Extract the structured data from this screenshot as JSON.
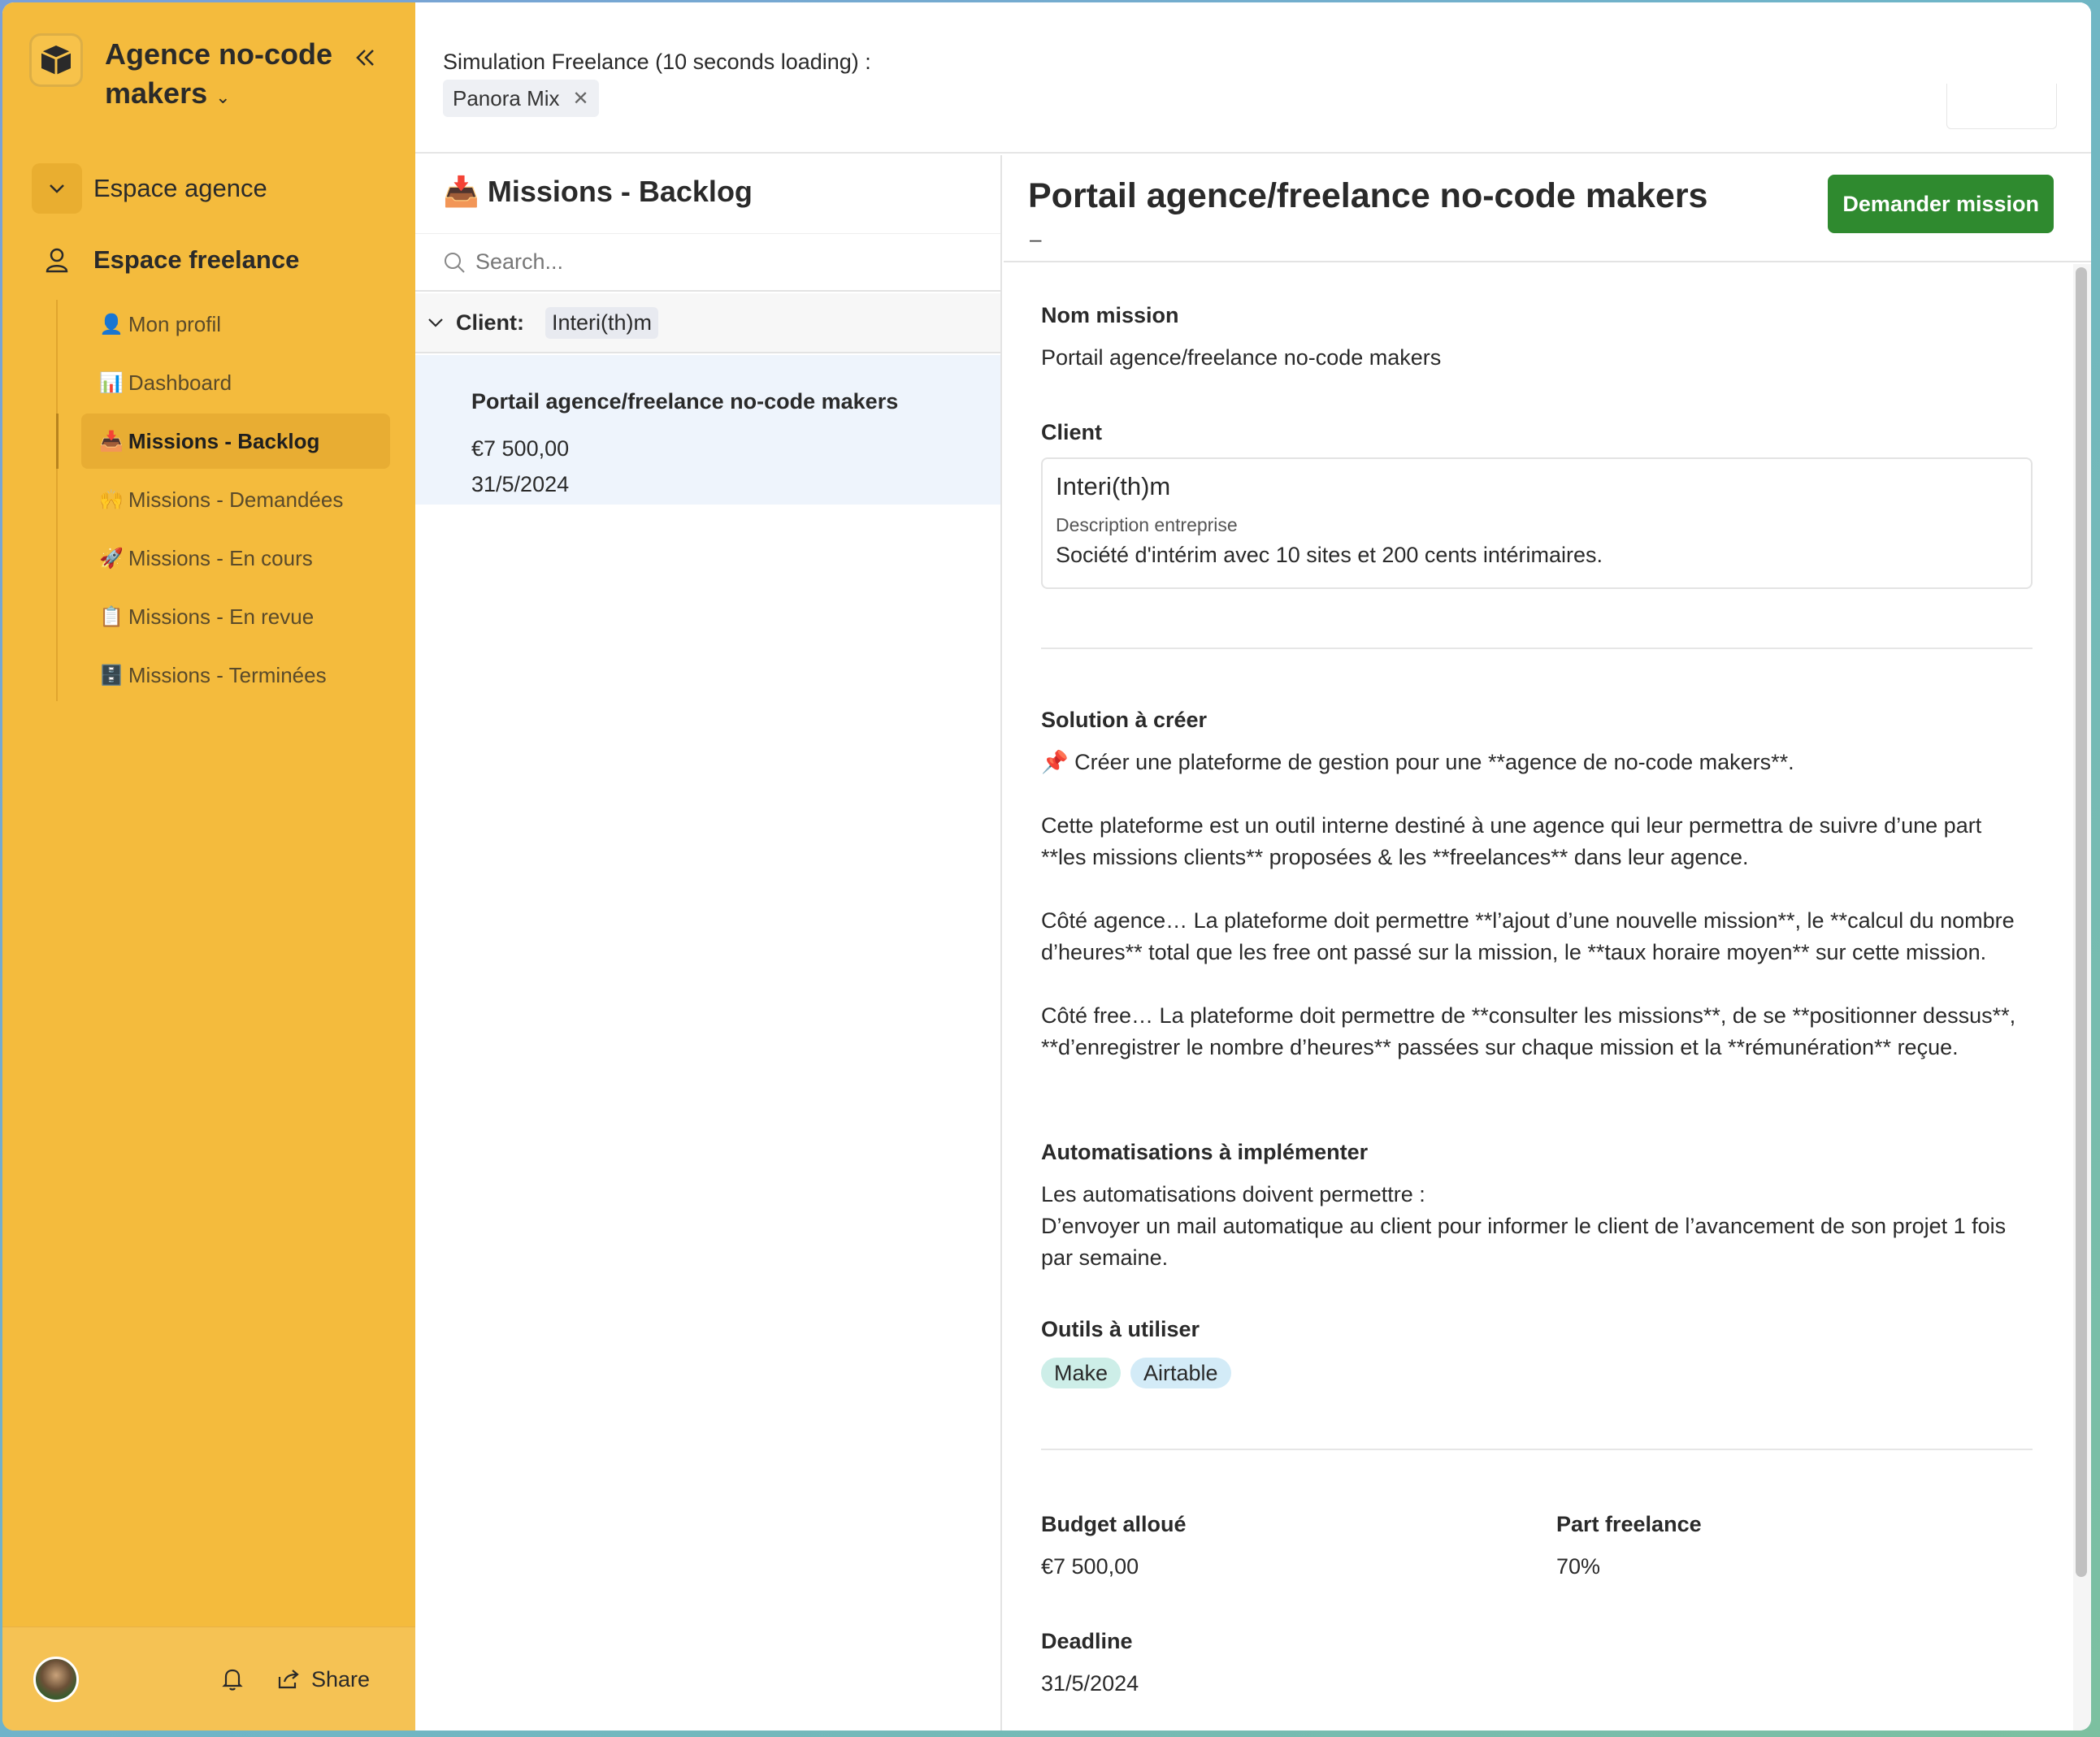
{
  "sidebar": {
    "org_name": "Agence no-code makers",
    "sections": [
      {
        "label": "Espace agence"
      },
      {
        "label": "Espace freelance"
      }
    ],
    "items": [
      {
        "emoji": "👤",
        "label": "Mon profil"
      },
      {
        "emoji": "📊",
        "label": "Dashboard"
      },
      {
        "emoji": "📥",
        "label": "Missions - Backlog"
      },
      {
        "emoji": "🙌",
        "label": "Missions - Demandées"
      },
      {
        "emoji": "🚀",
        "label": "Missions - En cours"
      },
      {
        "emoji": "📋",
        "label": "Missions - En revue"
      },
      {
        "emoji": "🗄️",
        "label": "Missions - Terminées"
      }
    ],
    "footer": {
      "share_label": "Share"
    }
  },
  "header": {
    "simulation_label": "Simulation Freelance (10 seconds loading) :",
    "chip_label": "Panora Mix",
    "chip_close": "✕"
  },
  "list": {
    "title_emoji": "📥",
    "title": "Missions - Backlog",
    "search_placeholder": "Search...",
    "group_label": "Client:",
    "group_value": "Interi(th)m",
    "card": {
      "title": "Portail agence/freelance no-code makers",
      "budget": "€7 500,00",
      "date": "31/5/2024"
    }
  },
  "detail": {
    "title": "Portail agence/freelance no-code makers",
    "subtitle_dash": "–",
    "demand_button": "Demander mission",
    "nom_mission_label": "Nom mission",
    "nom_mission_value": "Portail agence/freelance no-code makers",
    "client_label": "Client",
    "client": {
      "name": "Interi(th)m",
      "desc_label": "Description entreprise",
      "desc_value": "Société d'intérim avec 10 sites et 200 cents intérimaires."
    },
    "solution_label": "Solution à créer",
    "solution_p1": "📌 Créer une plateforme de gestion pour une **agence de no-code makers**.",
    "solution_p2a": "Cette plateforme est un outil interne destiné à une agence qui leur permettra de suivre d’une part",
    "solution_p2b": "**les missions clients** proposées & les **freelances** dans leur agence.",
    "solution_p3a": "Côté agence… La plateforme doit permettre **l’ajout d’une nouvelle mission**, le **calcul du nombre",
    "solution_p3b": "d’heures** total que les free ont passé sur la mission, le **taux horaire moyen** sur cette mission.",
    "solution_p4a": "Côté free… La plateforme doit permettre de **consulter les missions**, de se **positionner dessus**,",
    "solution_p4b": "**d’enregistrer le nombre d’heures** passées sur chaque mission et la **rémunération** reçue.",
    "auto_label": "Automatisations à implémenter",
    "auto_p1": "Les automatisations doivent permettre :",
    "auto_p2a": "D’envoyer un mail automatique au client pour informer le client de l’avancement de son projet 1 fois",
    "auto_p2b": "par semaine.",
    "tools_label": "Outils à utiliser",
    "tools": [
      {
        "label": "Make",
        "color": "#cdeee8"
      },
      {
        "label": "Airtable",
        "color": "#d3ebf7"
      }
    ],
    "budget_label": "Budget alloué",
    "budget_value": "€7 500,00",
    "part_label": "Part freelance",
    "part_value": "70%",
    "deadline_label": "Deadline",
    "deadline_value": "31/5/2024"
  },
  "colors": {
    "sidebar": "#f4bb3d",
    "accent_button": "#2f8a2f",
    "selected_card": "#eef4fc"
  }
}
